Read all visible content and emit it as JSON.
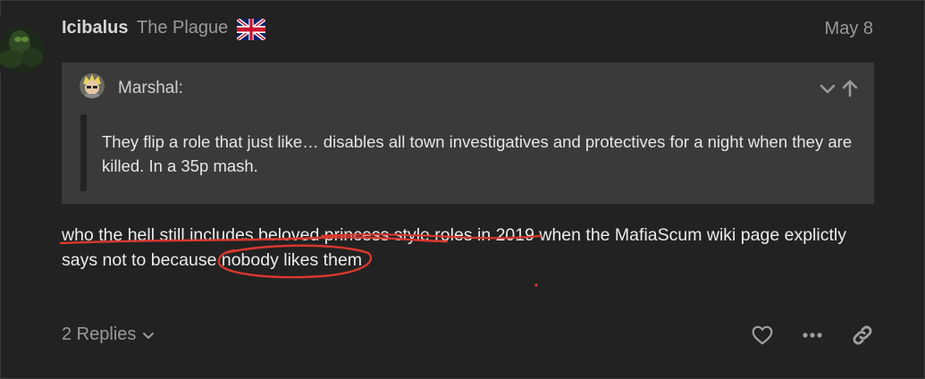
{
  "post": {
    "username": "Icibalus",
    "user_title": "The Plague",
    "date": "May 8",
    "quote": {
      "author": "Marshal:",
      "text": "They flip a role that just like… disables all town investigatives and protectives for a night when they are killed. In a 35p mash."
    },
    "body": "who the hell still includes beloved princess style roles in 2019 when the MafiaScum wiki page explictly says not to because nobody likes them",
    "replies_label": "2 Replies"
  },
  "icons": {
    "flag": "union-jack-flag-icon",
    "expand": "chevron-down-icon",
    "goto": "arrow-up-icon",
    "like": "heart-icon",
    "more": "ellipsis-icon",
    "share": "link-icon"
  },
  "colors": {
    "background": "#222222",
    "quote_background": "#3a3a3a",
    "annotation": "#d9382e"
  }
}
